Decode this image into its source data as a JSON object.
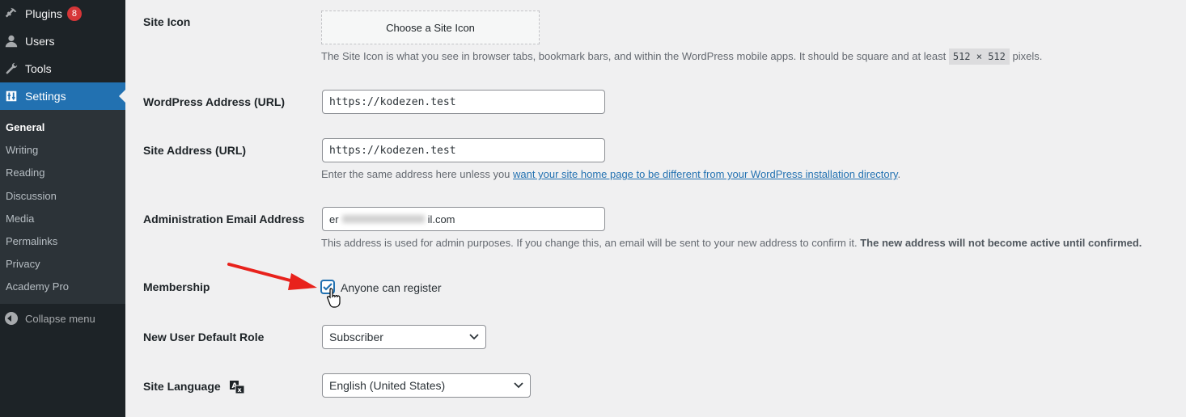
{
  "sidebar": {
    "menu": [
      {
        "label": "Plugins",
        "icon": "plugins-icon",
        "badge": "8"
      },
      {
        "label": "Users",
        "icon": "users-icon"
      },
      {
        "label": "Tools",
        "icon": "tools-icon"
      },
      {
        "label": "Settings",
        "icon": "settings-icon",
        "current": true
      }
    ],
    "submenu": [
      "General",
      "Writing",
      "Reading",
      "Discussion",
      "Media",
      "Permalinks",
      "Privacy",
      "Academy Pro"
    ],
    "active_submenu": "General",
    "collapse_label": "Collapse menu"
  },
  "form": {
    "site_icon": {
      "label": "Site Icon",
      "button": "Choose a Site Icon",
      "desc_before": "The Site Icon is what you see in browser tabs, bookmark bars, and within the WordPress mobile apps. It should be square and at least",
      "desc_code": "512 × 512",
      "desc_after": "pixels."
    },
    "wp_address": {
      "label": "WordPress Address (URL)",
      "value": "https://kodezen.test"
    },
    "site_address": {
      "label": "Site Address (URL)",
      "value": "https://kodezen.test",
      "desc_before": "Enter the same address here unless you",
      "desc_link": "want your site home page to be different from your WordPress installation directory",
      "desc_after": "."
    },
    "admin_email": {
      "label": "Administration Email Address",
      "value_start": "er",
      "value_end": "il.com",
      "desc": "This address is used for admin purposes. If you change this, an email will be sent to your new address to confirm it.",
      "desc_strong": "The new address will not become active until confirmed."
    },
    "membership": {
      "label": "Membership",
      "checkbox_label": "Anyone can register",
      "checked": true
    },
    "default_role": {
      "label": "New User Default Role",
      "value": "Subscriber"
    },
    "site_language": {
      "label": "Site Language",
      "value": "English (United States)"
    }
  },
  "colors": {
    "sidebar_bg": "#1d2327",
    "accent": "#2271b1",
    "badge": "#d63638",
    "arrow": "#e8221c"
  }
}
